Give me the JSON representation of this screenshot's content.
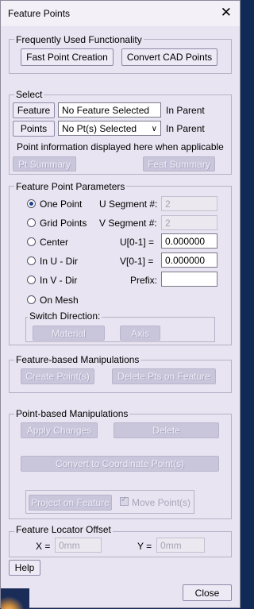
{
  "window": {
    "title": "Feature Points",
    "close_glyph": "✕"
  },
  "frequently_used": {
    "legend": "Frequently Used Functionality",
    "fast_point_creation": "Fast Point Creation",
    "convert_cad_points": "Convert CAD Points"
  },
  "select": {
    "legend": "Select",
    "feature_button": "Feature",
    "feature_value": "No Feature Selected",
    "feature_suffix": "In Parent",
    "points_button": "Points",
    "points_value": "No Pt(s) Selected",
    "points_suffix": "In Parent",
    "info_text": "Point information displayed here when applicable",
    "pt_summary": "Pt Summary",
    "feat_summary": "Feat Summary"
  },
  "parameters": {
    "legend": "Feature Point Parameters",
    "radios": [
      {
        "label": "One Point",
        "selected": true
      },
      {
        "label": "Grid Points",
        "selected": false
      },
      {
        "label": "Center",
        "selected": false
      },
      {
        "label": "In U - Dir",
        "selected": false
      },
      {
        "label": "In V - Dir",
        "selected": false
      },
      {
        "label": "On Mesh",
        "selected": false
      }
    ],
    "u_segment_label": "U Segment #:",
    "u_segment_value": "2",
    "v_segment_label": "V Segment #:",
    "v_segment_value": "2",
    "u_label": "U[0-1] =",
    "u_value": "0.000000",
    "v_label": "V[0-1] =",
    "v_value": "0.000000",
    "prefix_label": "Prefix:",
    "prefix_value": "",
    "switch_direction": {
      "legend": "Switch Direction:",
      "material": "Material",
      "axis": "Axis"
    }
  },
  "feature_manip": {
    "legend": "Feature-based Manipulations",
    "create_points": "Create Point(s)",
    "delete_pts_on_feature": "Delete Pts on Feature"
  },
  "point_manip": {
    "legend": "Point-based Manipulations",
    "apply_changes": "Apply Changes",
    "delete": "Delete",
    "convert_to_coordinate": "Convert to Coordinate Point(s)",
    "project_on_feature": "Project on Feature",
    "move_points": "Move Point(s)"
  },
  "locator": {
    "legend": "Feature Locator Offset",
    "x_label": "X =",
    "x_value": "0mm",
    "y_label": "Y =",
    "y_value": "0mm"
  },
  "footer": {
    "help": "Help",
    "close": "Close"
  }
}
